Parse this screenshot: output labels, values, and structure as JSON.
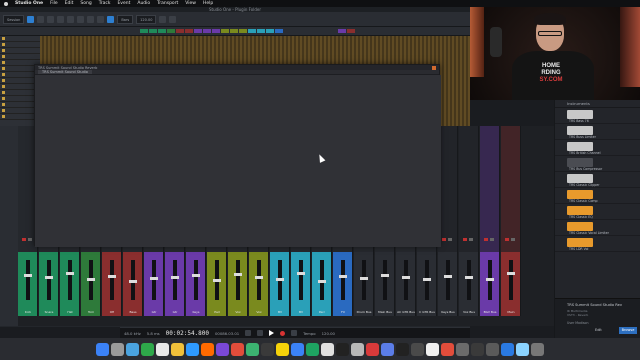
{
  "menubar": {
    "app": "Studio One",
    "items": [
      "File",
      "Edit",
      "Song",
      "Track",
      "Event",
      "Audio",
      "Transport",
      "View",
      "Help"
    ]
  },
  "window_title": "Studio One - Plugin Folder",
  "toolbar": {
    "song_box": "Session",
    "tempo_box": "120.00",
    "timebase": "Bars"
  },
  "plugin_window": {
    "title": "TRS Summit Sound Studio Reverb",
    "tab": "TRS Summit Sound Studio"
  },
  "mixer": {
    "channel_names": [
      "Kick",
      "Snare",
      "Hat",
      "Tom",
      "OH",
      "Bass",
      "Gtr",
      "Gtr",
      "Keys",
      "Pad",
      "Vox",
      "Vox",
      "BV",
      "BV",
      "Perc",
      "FX",
      "Drum Bus",
      "Main Bus",
      "AC GTR Bus",
      "C GTR Bus",
      "Keys Bus",
      "Vox Bus",
      "BGV Bus",
      "Main"
    ],
    "channel_colors": [
      "#1f8a5a",
      "#1f8a5a",
      "#1f8a5a",
      "#2e7a3a",
      "#8a2e2e",
      "#8a2e2e",
      "#6a3aa8",
      "#6a3aa8",
      "#6a3aa8",
      "#7a8a1e",
      "#7a8a1e",
      "#7a8a1e",
      "#2aa0b8",
      "#2aa0b8",
      "#2aa0b8",
      "#2a6ac0",
      "#2a2d33",
      "#2a2d33",
      "#2a2d33",
      "#2a2d33",
      "#2a2d33",
      "#2a2d33",
      "#6a3aa8",
      "#8a2e2e"
    ]
  },
  "transport": {
    "sample_rate": "48.0 kHz",
    "latency": "5.8 ms",
    "time": "00:02:54.800",
    "bars": "00086.03.01",
    "tempo_label": "Tempo",
    "tempo": "120.00"
  },
  "browser": {
    "header": "Instruments",
    "items": [
      {
        "label": "TRS Bass 76",
        "thumb": "silver"
      },
      {
        "label": "TRS Buss Limiter",
        "thumb": "silver"
      },
      {
        "label": "TRS British Channel",
        "thumb": "silver"
      },
      {
        "label": "TRS Bus Compressor",
        "thumb": "dark"
      },
      {
        "label": "TRS Classic Clipper",
        "thumb": "silver"
      },
      {
        "label": "TRS Classic Comp",
        "thumb": "orange"
      },
      {
        "label": "TRS Classic EQ",
        "thumb": "orange"
      },
      {
        "label": "TRS Classic Vocal Limiter",
        "thumb": "orange"
      },
      {
        "label": "TRS LDR Vol",
        "thumb": "orange"
      }
    ],
    "footer_name": "TRS Summit Sound Studio Rev",
    "footer_sub": "IK Multimedia\nVST3 - Reverb",
    "footer_user": "User Madison",
    "btn_edit": "Edit",
    "btn_browse": "Browse"
  },
  "webcam": {
    "shirt_line1": "HOME",
    "shirt_line2": "RDING",
    "shirt_line3": "SY.COM"
  },
  "dock_colors": [
    "#3b82f6",
    "#9a9a9a",
    "#4aa3df",
    "#2ea84a",
    "#e9e9e9",
    "#f0c03a",
    "#2e9aff",
    "#ff6a00",
    "#7a48d8",
    "#e24d3b",
    "#3cb371",
    "#3a3a3a",
    "#f5d20a",
    "#3b82f6",
    "#1ea362",
    "#e0e0e0",
    "#222",
    "#b8b8b8",
    "#d83a3a",
    "#5b7de8",
    "#222",
    "#4a4a4a",
    "#f0f0f0",
    "#e24d3b",
    "#6b6b6b",
    "#3a3a3a",
    "#5a5a5a",
    "#2a7ae2",
    "#8bd3ff",
    "#777"
  ]
}
